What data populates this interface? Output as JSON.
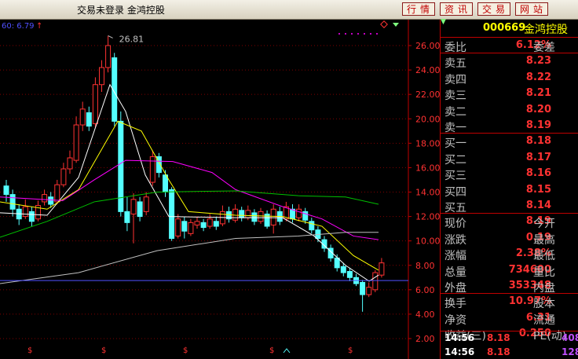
{
  "window": {
    "title": "交易未登录  金鸿控股",
    "buttons": [
      "行情",
      "资讯",
      "交易",
      "网站"
    ]
  },
  "chart": {
    "ma_label": "60: 6.79",
    "ma_arrow": "↑",
    "peak_label": "26.81",
    "indicators": [
      "red-dots",
      "diamond",
      "dropdown"
    ],
    "y_ticks": [
      "26.00",
      "24.00",
      "22.00",
      "20.00",
      "18.00",
      "16.00",
      "14.00",
      "12.00",
      "10.00",
      "8.00",
      "6.00",
      "4.00",
      "2.00"
    ],
    "colors": {
      "up": "#ff3232",
      "down": "#54ffff",
      "ma5": "#ffffff",
      "ma10": "#ffff00",
      "ma20": "#ff00ff",
      "ma60": "#00c000",
      "grid": "#800000",
      "axis": "#c00000"
    }
  },
  "quote": {
    "code": "000669",
    "name": "金鸿控股",
    "rows": [
      {
        "label": "委比",
        "value": "6.12%",
        "label2": "委差"
      },
      {
        "label": "卖五",
        "value": "8.23"
      },
      {
        "label": "卖四",
        "value": "8.22"
      },
      {
        "label": "卖三",
        "value": "8.21"
      },
      {
        "label": "卖二",
        "value": "8.20"
      },
      {
        "label": "卖一",
        "value": "8.19"
      },
      {
        "label": "买一",
        "value": "8.18"
      },
      {
        "label": "买二",
        "value": "8.17"
      },
      {
        "label": "买三",
        "value": "8.16"
      },
      {
        "label": "买四",
        "value": "8.15"
      },
      {
        "label": "买五",
        "value": "8.14"
      },
      {
        "label": "现价",
        "value": "8.19",
        "label2": "今开"
      },
      {
        "label": "涨跌",
        "value": "0.19",
        "label2": "最高"
      },
      {
        "label": "涨幅",
        "value": "2.38%",
        "label2": "最低"
      },
      {
        "label": "总量",
        "value": "734600",
        "label2": "量比"
      },
      {
        "label": "外盘",
        "value": "353348",
        "label2": "内盘"
      },
      {
        "label": "换手",
        "value": "10.97%",
        "label2": "股本"
      },
      {
        "label": "净资",
        "value": "6.31",
        "label2": "流通"
      },
      {
        "label": "收益(三)",
        "value": "0.250",
        "label2": "PE(动)"
      }
    ],
    "ticks": [
      {
        "time": "14:56",
        "price": "8.18",
        "vol": "408"
      },
      {
        "time": "14:56",
        "price": "8.18",
        "vol": "128"
      }
    ]
  }
}
